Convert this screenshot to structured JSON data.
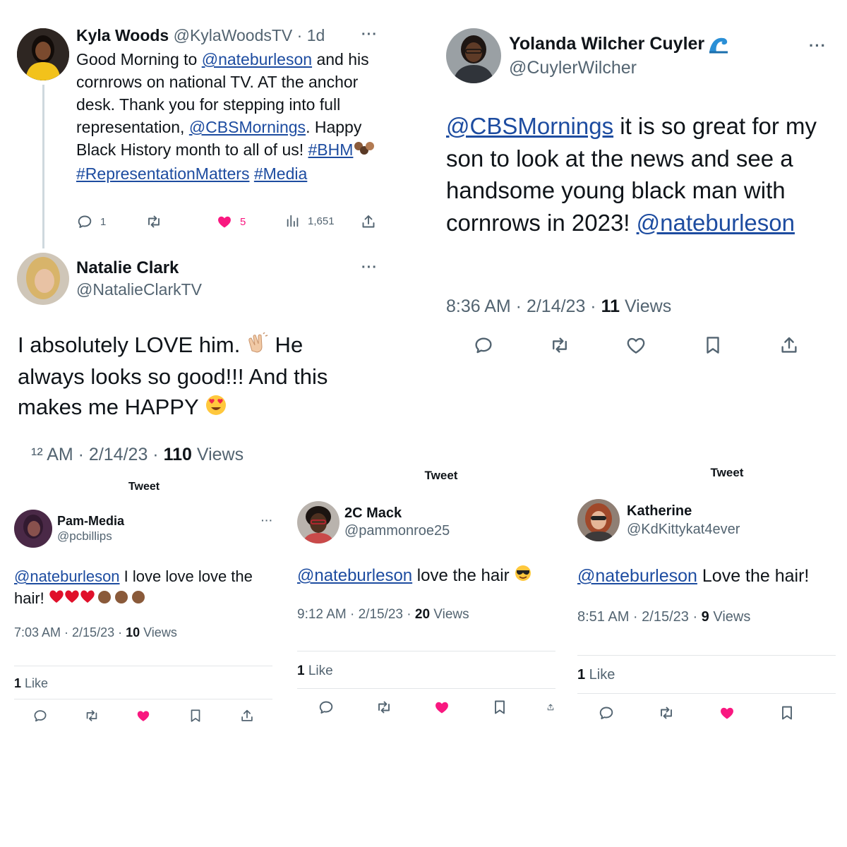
{
  "kyla": {
    "name": "Kyla Woods",
    "meta": "@KylaWoodsTV · 1d",
    "text_1": "Good Morning to ",
    "mention_1": "@nateburleson",
    "text_2": " and his cornrows on national TV. AT the anchor desk. Thank you for stepping into full representation, ",
    "mention_2": "@CBSMornings",
    "text_3": ". Happy Black History month to all of us! ",
    "tag_1": "#BHM",
    "tag_2": "#RepresentationMatters",
    "tag_3": "#Media",
    "replies": "1",
    "likes": "5",
    "views": "1,651",
    "more": "···"
  },
  "natalie": {
    "name": "Natalie Clark",
    "handle": "@NatalieClarkTV",
    "text_1": "I absolutely LOVE him. ",
    "text_2": " He always looks so good!!! And this makes me HAPPY ",
    "time_prefix": "¹² AM · 2/14/23 · ",
    "views_count": "110",
    "views_label": " Views",
    "more": "···"
  },
  "yolanda": {
    "name": "Yolanda Wilcher Cuyler",
    "handle": "@CuylerWilcher",
    "mention_1": "@CBSMornings",
    "text_1": " it is so great for my son to look at the news and see a handsome young black man with cornrows in 2023! ",
    "mention_2": "@nateburleson",
    "time_prefix": "8:36 AM · 2/14/23 · ",
    "views_count": "11",
    "views_label": " Views",
    "more": "···"
  },
  "pam": {
    "header": "Tweet",
    "name": "Pam-Media",
    "handle": "@pcbillips",
    "mention": "@nateburleson",
    "text": " I love love love the hair! ",
    "time_prefix": "7:03 AM · 2/15/23 · ",
    "views_count": "10",
    "views_label": " Views",
    "likes_count": "1",
    "likes_label": " Like",
    "more": "···"
  },
  "mack": {
    "header": "Tweet",
    "name": "2C Mack",
    "handle": "@pammonroe25",
    "mention": "@nateburleson",
    "text": " love the hair ",
    "time_prefix": "9:12 AM · 2/15/23 · ",
    "views_count": "20",
    "views_label": " Views",
    "likes_count": "1",
    "likes_label": " Like"
  },
  "katherine": {
    "header": "Tweet",
    "name": "Katherine",
    "handle": "@KdKittykat4ever",
    "mention": "@nateburleson",
    "text": " Love the hair!",
    "time_prefix": "8:51 AM · 2/15/23 · ",
    "views_count": "9",
    "views_label": " Views",
    "likes_count": "1",
    "likes_label": " Like"
  },
  "colors": {
    "link": "#1d4ca0",
    "like_pink": "#f91880",
    "muted": "#536471",
    "text": "#0f1419"
  }
}
